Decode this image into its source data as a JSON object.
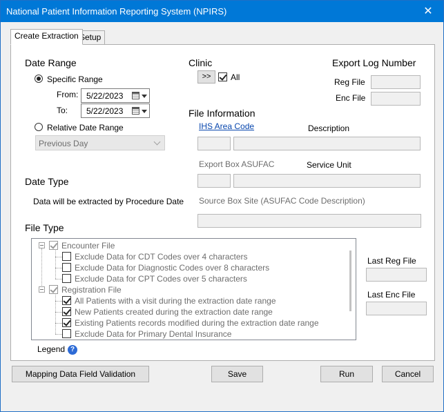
{
  "window": {
    "title": "National Patient Information Reporting System (NPIRS)",
    "close_glyph": "✕"
  },
  "tabs": [
    {
      "label": "Create Extraction"
    },
    {
      "label": "Setup"
    }
  ],
  "date_range": {
    "heading": "Date Range",
    "specific_label": "Specific Range",
    "from_label": "From:",
    "from_value": "5/22/2023",
    "to_label": "To:",
    "to_value": "5/22/2023",
    "relative_label": "Relative Date Range",
    "relative_selected": "Previous Day",
    "selected_mode": "specific"
  },
  "clinic": {
    "heading": "Clinic",
    "button_label": ">>",
    "all_label": "All",
    "all_checked": true
  },
  "export_log": {
    "heading": "Export Log Number",
    "reg_file_label": "Reg File",
    "enc_file_label": "Enc File"
  },
  "file_info": {
    "heading": "File Information",
    "ihs_area_code_label": "IHS Area Code",
    "description_label": "Description",
    "export_box_label": "Export Box ASUFAC",
    "service_unit_label": "Service Unit",
    "source_box_label": "Source Box Site (ASUFAC Code Description)"
  },
  "date_type": {
    "heading": "Date Type",
    "text": "Data will be extracted by Procedure Date"
  },
  "file_type": {
    "heading": "File Type",
    "tree": [
      {
        "label": "Encounter File",
        "checked": true,
        "parent": true
      },
      {
        "label": "Exclude Data for CDT Codes over 4 characters",
        "checked": false
      },
      {
        "label": "Exclude Data for Diagnostic Codes over 8 characters",
        "checked": false
      },
      {
        "label": "Exclude Data for CPT Codes over 5 characters",
        "checked": false
      },
      {
        "label": "Registration File",
        "checked": true,
        "parent": true
      },
      {
        "label": "All Patients with a visit during the extraction date range",
        "checked": true
      },
      {
        "label": "New Patients created during the extraction date range",
        "checked": true
      },
      {
        "label": "Existing Patients records modified during the extraction date range",
        "checked": true
      },
      {
        "label": "Exclude Data for Primary Dental Insurance",
        "checked": false
      }
    ]
  },
  "last_files": {
    "last_reg_label": "Last Reg File",
    "last_enc_label": "Last Enc File"
  },
  "legend": {
    "label": "Legend",
    "help_glyph": "?"
  },
  "buttons": {
    "mapping": "Mapping Data Field Validation",
    "save": "Save",
    "run": "Run",
    "cancel": "Cancel"
  },
  "colors": {
    "titlebar": "#0078d7",
    "link": "#0645ad",
    "help_icon": "#2d6bd6"
  }
}
